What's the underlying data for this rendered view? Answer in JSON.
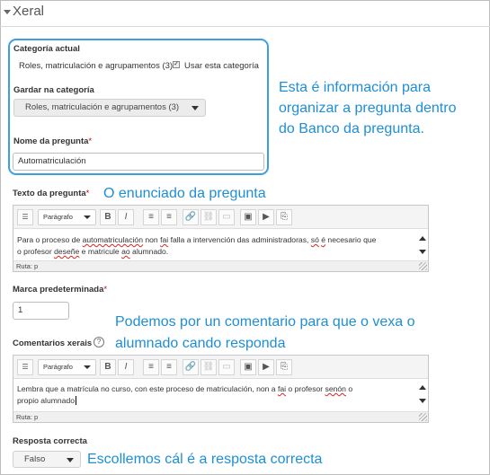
{
  "section": {
    "title": "Xeral"
  },
  "category": {
    "current_label": "Categoría actual",
    "current_value": "Roles, matriculación e agrupamentos (3)",
    "use_this_label": "Usar esta categoría",
    "save_in_label": "Gardar na categoría",
    "save_in_value": "Roles, matriculación e agrupamentos (3)"
  },
  "question_name": {
    "label": "Nome da pregunta",
    "value": "Automatriculación"
  },
  "question_text": {
    "label": "Texto da pregunta",
    "format": "Parágrafo",
    "line1": [
      "Para o proceso de ",
      "automatriculación",
      " non ",
      "fai",
      " falla a intervención das administradoras, ",
      "só",
      " ",
      "é",
      " necesario que"
    ],
    "line2": [
      "o profesor ",
      "deseñe",
      " e matricule ",
      "ao",
      " alumnado."
    ],
    "path": "Ruta: p"
  },
  "default_mark": {
    "label": "Marca predeterminada",
    "value": "1"
  },
  "general_feedback": {
    "label": "Comentarios xerais",
    "format": "Parágrafo",
    "line1": [
      "Lembra que a matrícula no curso, con este proceso de matriculación, non a ",
      "fai",
      " o profesor ",
      "senón",
      " o"
    ],
    "line2": [
      "propio alumnado"
    ],
    "path": "Ruta: p"
  },
  "correct_answer": {
    "label": "Resposta correcta",
    "value": "Falso"
  },
  "required_mark": "*",
  "help_icon_glyph": "?",
  "annotations": {
    "category_line1": "Esta é información para",
    "category_line2": "organizar a pregunta dentro",
    "category_line3": "do Banco da pregunta.",
    "question_text": "O enunciado da pregunta",
    "feedback_line1": "Podemos por un comentario para que o vexa o",
    "feedback_line2": "alumnado cando responda",
    "answer": "Escollemos cál é a resposta correcta"
  },
  "toolbar_buttons": [
    "B",
    "I",
    "≡",
    "≡",
    "🔗",
    "⛓",
    "▭",
    "▣",
    "▶",
    "⎘"
  ],
  "colors": {
    "annotation": "#1e8ed6",
    "callout_border": "#3aa0e0",
    "required": "#cc0000"
  }
}
